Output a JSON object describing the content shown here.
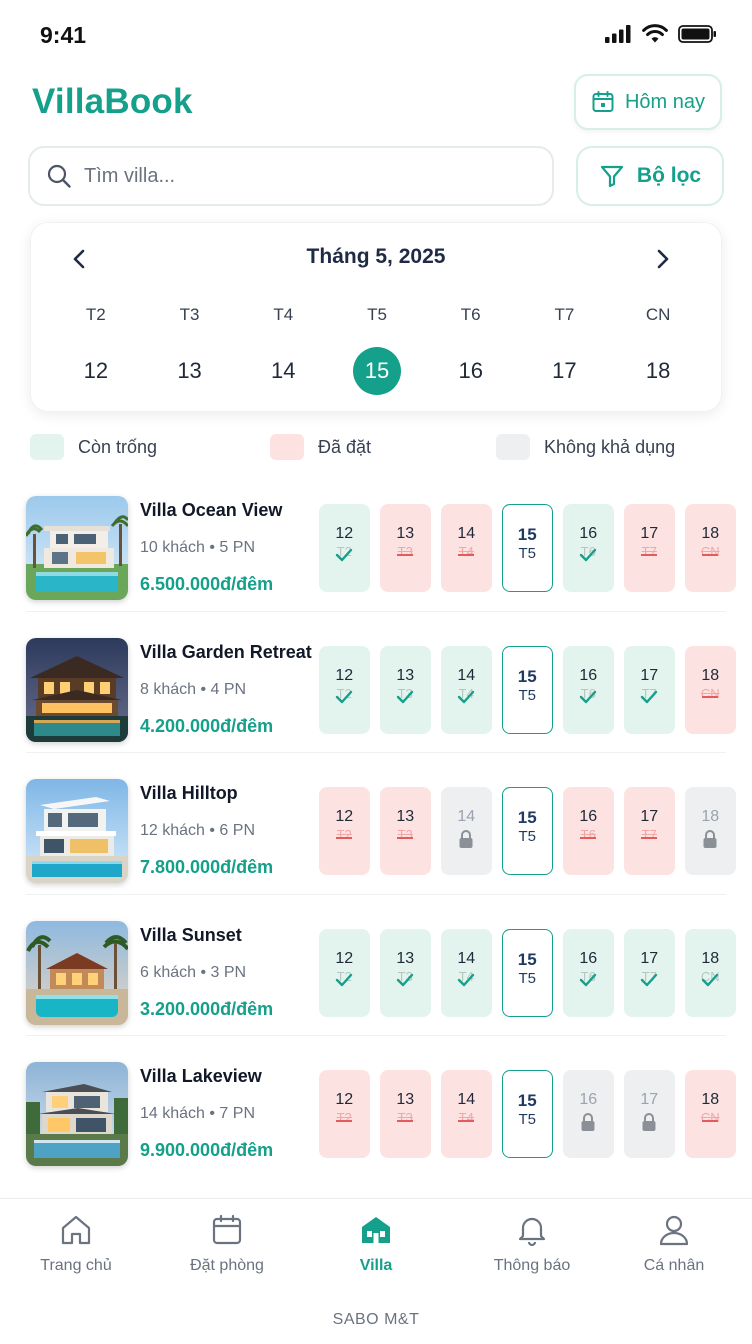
{
  "status_bar": {
    "time": "9:41"
  },
  "header": {
    "title": "VillaBook",
    "today_button": "Hôm nay"
  },
  "search": {
    "placeholder": "Tìm villa...",
    "value": "",
    "filter_button": "Bộ lọc"
  },
  "calendar": {
    "month_label": "Tháng 5, 2025",
    "weekdays": [
      "T2",
      "T3",
      "T4",
      "T5",
      "T6",
      "T7",
      "CN"
    ],
    "days": [
      "12",
      "13",
      "14",
      "15",
      "16",
      "17",
      "18"
    ],
    "selected_day": "15"
  },
  "legend": {
    "available": "Còn trống",
    "booked": "Đã đặt",
    "unavailable": "Không khả dụng"
  },
  "villas": [
    {
      "name": "Villa Ocean View",
      "meta": "10 khách • 5 PN",
      "price": "6.500.000đ/đêm",
      "slots": [
        {
          "day": "12",
          "wd": "T2",
          "status": "available"
        },
        {
          "day": "13",
          "wd": "T3",
          "status": "booked"
        },
        {
          "day": "14",
          "wd": "T4",
          "status": "booked"
        },
        {
          "day": "15",
          "wd": "T5",
          "status": "today"
        },
        {
          "day": "16",
          "wd": "T6",
          "status": "available"
        },
        {
          "day": "17",
          "wd": "T7",
          "status": "booked"
        },
        {
          "day": "18",
          "wd": "CN",
          "status": "booked"
        }
      ]
    },
    {
      "name": "Villa Garden Retreat",
      "meta": "8 khách • 4 PN",
      "price": "4.200.000đ/đêm",
      "slots": [
        {
          "day": "12",
          "wd": "T2",
          "status": "available"
        },
        {
          "day": "13",
          "wd": "T3",
          "status": "available"
        },
        {
          "day": "14",
          "wd": "T4",
          "status": "available"
        },
        {
          "day": "15",
          "wd": "T5",
          "status": "today"
        },
        {
          "day": "16",
          "wd": "T6",
          "status": "available"
        },
        {
          "day": "17",
          "wd": "T7",
          "status": "available"
        },
        {
          "day": "18",
          "wd": "CN",
          "status": "booked"
        }
      ]
    },
    {
      "name": "Villa Hilltop",
      "meta": "12 khách • 6 PN",
      "price": "7.800.000đ/đêm",
      "slots": [
        {
          "day": "12",
          "wd": "T2",
          "status": "booked"
        },
        {
          "day": "13",
          "wd": "T3",
          "status": "booked"
        },
        {
          "day": "14",
          "wd": "T4",
          "status": "unavailable"
        },
        {
          "day": "15",
          "wd": "T5",
          "status": "today"
        },
        {
          "day": "16",
          "wd": "T6",
          "status": "booked"
        },
        {
          "day": "17",
          "wd": "T7",
          "status": "booked"
        },
        {
          "day": "18",
          "wd": "CN",
          "status": "unavailable"
        }
      ]
    },
    {
      "name": "Villa Sunset",
      "meta": "6 khách • 3 PN",
      "price": "3.200.000đ/đêm",
      "slots": [
        {
          "day": "12",
          "wd": "T2",
          "status": "available"
        },
        {
          "day": "13",
          "wd": "T3",
          "status": "available"
        },
        {
          "day": "14",
          "wd": "T4",
          "status": "available"
        },
        {
          "day": "15",
          "wd": "T5",
          "status": "today"
        },
        {
          "day": "16",
          "wd": "T6",
          "status": "available"
        },
        {
          "day": "17",
          "wd": "T7",
          "status": "available"
        },
        {
          "day": "18",
          "wd": "CN",
          "status": "available"
        }
      ]
    },
    {
      "name": "Villa Lakeview",
      "meta": "14 khách • 7 PN",
      "price": "9.900.000đ/đêm",
      "slots": [
        {
          "day": "12",
          "wd": "T2",
          "status": "booked"
        },
        {
          "day": "13",
          "wd": "T3",
          "status": "booked"
        },
        {
          "day": "14",
          "wd": "T4",
          "status": "booked"
        },
        {
          "day": "15",
          "wd": "T5",
          "status": "today"
        },
        {
          "day": "16",
          "wd": "T6",
          "status": "unavailable"
        },
        {
          "day": "17",
          "wd": "T7",
          "status": "unavailable"
        },
        {
          "day": "18",
          "wd": "CN",
          "status": "booked"
        }
      ]
    }
  ],
  "bottom_nav": {
    "items": [
      {
        "label": "Trang chủ",
        "icon": "home-icon"
      },
      {
        "label": "Đặt phòng",
        "icon": "calendar-icon"
      },
      {
        "label": "Villa",
        "icon": "villa-icon",
        "active": true
      },
      {
        "label": "Thông báo",
        "icon": "bell-icon"
      },
      {
        "label": "Cá nhân",
        "icon": "user-icon"
      }
    ],
    "brand": "SABO M&T"
  },
  "colors": {
    "accent": "#14a08a",
    "available": "#e3f4ee",
    "booked": "#fde2e2",
    "unavailable": "#eeeff1",
    "booked_mark": "#e35b5b"
  }
}
